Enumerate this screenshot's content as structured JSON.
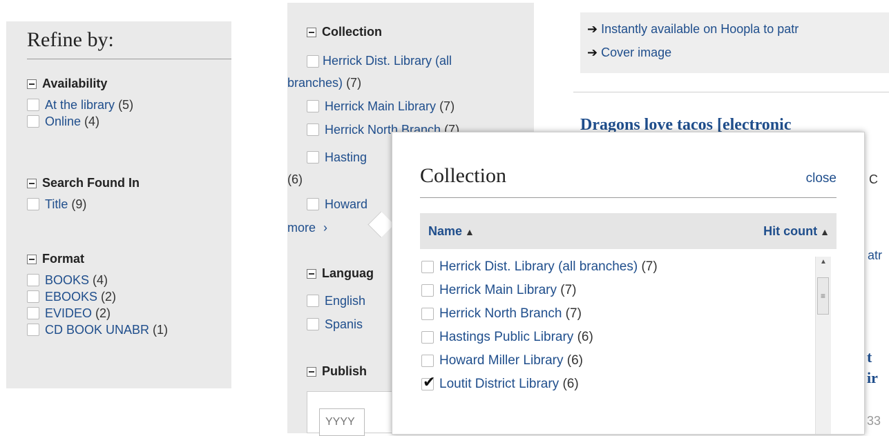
{
  "left_panel": {
    "title": "Refine by:",
    "facets": [
      {
        "name": "Availability",
        "items": [
          {
            "label": "At the library",
            "count": "(5)"
          },
          {
            "label": "Online",
            "count": "(4)"
          }
        ]
      },
      {
        "name": "Search Found In",
        "items": [
          {
            "label": "Title",
            "count": "(9)"
          }
        ]
      },
      {
        "name": "Format",
        "items": [
          {
            "label": "BOOKS",
            "count": "(4)"
          },
          {
            "label": "EBOOKS",
            "count": "(2)"
          },
          {
            "label": "EVIDEO",
            "count": "(2)"
          },
          {
            "label": "CD BOOK UNABR",
            "count": "(1)"
          }
        ]
      }
    ]
  },
  "mid_panel": {
    "collection_heading": "Collection",
    "collection_items": [
      {
        "label": "Herrick Dist. Library (all",
        "label2": "branches)",
        "count": "(7)"
      },
      {
        "label": "Herrick Main Library",
        "count": "(7)"
      },
      {
        "label": "Herrick North Branch",
        "count": "(7)"
      },
      {
        "label": "Hasting",
        "count": "(6)"
      },
      {
        "label": "Howard",
        "count": ""
      }
    ],
    "more_label": "more",
    "language_heading": "Languag",
    "language_items": [
      {
        "label": "English"
      },
      {
        "label": "Spanis"
      }
    ],
    "publish_heading": "Publish",
    "year_placeholder": "YYYY"
  },
  "right_content": {
    "links": [
      "Instantly available on Hoopla to patr",
      "Cover image"
    ],
    "result_title": "Dragons love tacos [electronic",
    "fragments": [
      "C",
      "atr",
      "t",
      "ir",
      "33"
    ]
  },
  "popup": {
    "title": "Collection",
    "close_label": "close",
    "col_name": "Name",
    "col_hits": "Hit count",
    "items": [
      {
        "label": "Herrick Dist. Library (all branches)",
        "count": "(7)",
        "checked": false
      },
      {
        "label": "Herrick Main Library",
        "count": "(7)",
        "checked": false
      },
      {
        "label": "Herrick North Branch",
        "count": "(7)",
        "checked": false
      },
      {
        "label": "Hastings Public Library",
        "count": "(6)",
        "checked": false
      },
      {
        "label": "Howard Miller Library",
        "count": "(6)",
        "checked": false
      },
      {
        "label": "Loutit District Library",
        "count": "(6)",
        "checked": true
      }
    ]
  },
  "colors": {
    "link": "#1f4e8c",
    "panel_bg": "#eaeaea",
    "result_title": "#1f4e8c"
  }
}
